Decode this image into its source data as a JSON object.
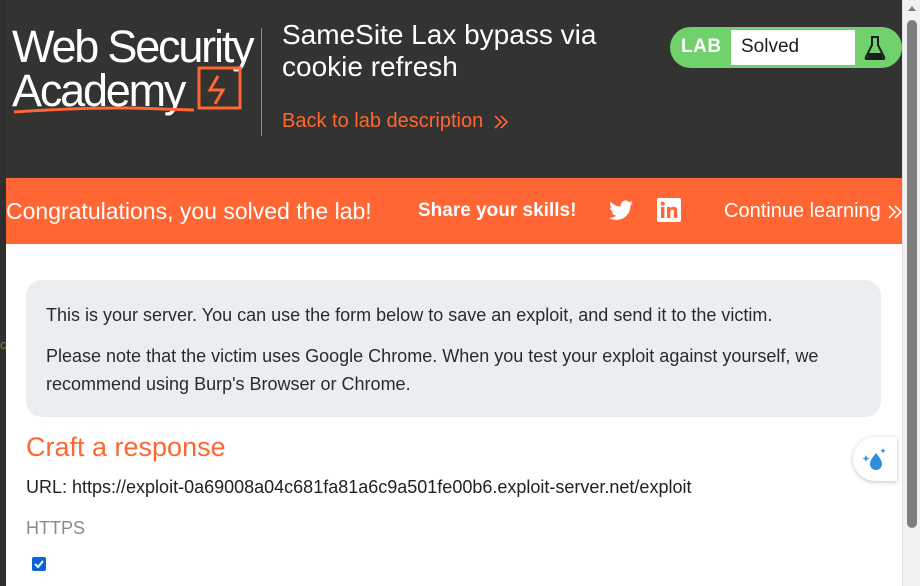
{
  "logo": {
    "line1": "Web Security",
    "line2": "Academy"
  },
  "lab": {
    "title": "SameSite Lax bypass via cookie refresh",
    "back_link": "Back to lab description",
    "badge_label": "LAB",
    "status": "Solved"
  },
  "congrats": {
    "message": "Congratulations, you solved the lab!",
    "share": "Share your skills!",
    "continue": "Continue learning"
  },
  "info": {
    "line1": "This is your server. You can use the form below to save an exploit, and send it to the victim.",
    "line2": "Please note that the victim uses Google Chrome. When you test your exploit against yourself, we recommend using Burp's Browser or Chrome."
  },
  "form": {
    "heading": "Craft a response",
    "url": "URL: https://exploit-0a69008a04c681fa81a6c9a501fe00b6.exploit-server.net/exploit",
    "https_label": "HTTPS",
    "https_checked": true
  },
  "left_fragment": "c",
  "colors": {
    "accent": "#ff6633",
    "header_bg": "#333332",
    "solved_green": "#70d16d",
    "info_bg": "#ebeef0"
  },
  "icons": [
    "twitter-icon",
    "linkedin-icon",
    "flask-icon",
    "chevron-double-right-icon",
    "sparkle-drop-icon",
    "checkmark-icon"
  ]
}
